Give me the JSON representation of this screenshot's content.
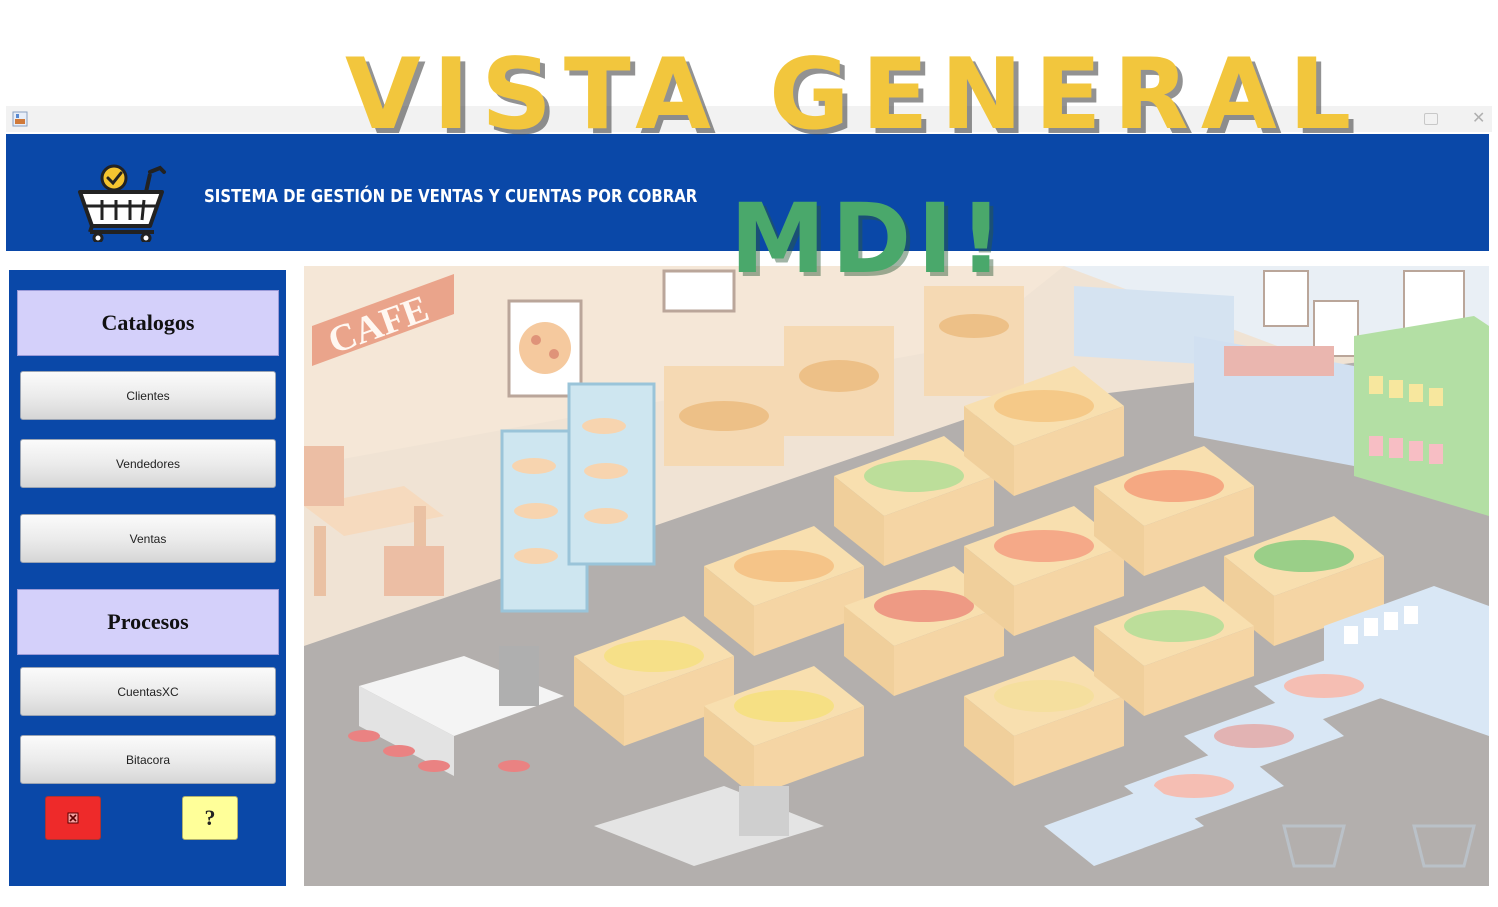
{
  "overlay": {
    "title": "VISTA GENERAL",
    "subtitle": "MDI!"
  },
  "window": {
    "icon": "java-app-icon",
    "maximize_icon": "maximize-icon",
    "close_icon": "close-icon",
    "close_glyph": "✕"
  },
  "header": {
    "logo": "shopping-cart-check-icon",
    "title": "SISTEMA DE GESTIÓN DE VENTAS Y CUENTAS POR COBRAR",
    "background": "#0a48a8"
  },
  "sidebar": {
    "catalogos_label": "Catalogos",
    "catalogos_items": [
      "Clientes",
      "Vendedores",
      "Ventas"
    ],
    "procesos_label": "Procesos",
    "procesos_items": [
      "CuentasXC",
      "Bitacora"
    ],
    "exit_icon": "exit-x-icon",
    "help_label": "?"
  },
  "desktop": {
    "background_image": "supermarket-isometric-illustration",
    "signage": "CAFE"
  },
  "colors": {
    "accent_blue": "#0a48a8",
    "section_header": "#d4d0fa",
    "exit_button": "#ee2a2a",
    "help_button": "#ffff99",
    "overlay_yellow": "#f2c63d",
    "overlay_green": "#4aa86b"
  }
}
